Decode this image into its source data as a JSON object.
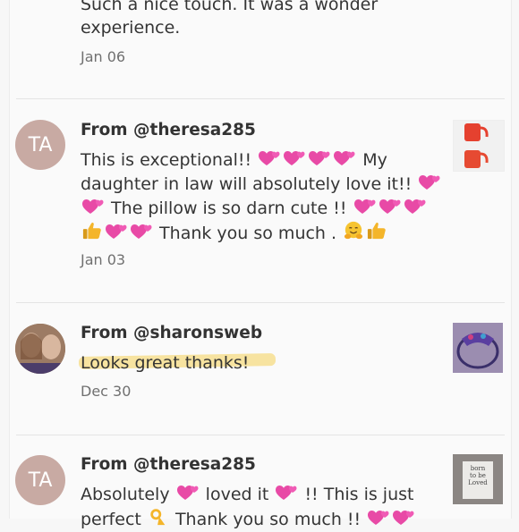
{
  "review0": {
    "text_line1": "Such a nice touch. It was a wonder",
    "text_line2": "experience.",
    "date": "Jan 06"
  },
  "review1": {
    "from": "From @theresa285",
    "avatar_initials": "TA",
    "line1_a": "This is exceptional!!",
    "line1_b": "My",
    "line2_a": "daughter in law will absolutely love it!!",
    "line3_a": "The pillow is so darn cute !!",
    "line4_a": "Thank you so much .",
    "date": "Jan 03"
  },
  "review2": {
    "from": "From @sharonsweb",
    "text": "Looks great thanks!",
    "date": "Dec 30",
    "highlight_color": "#f7e3a0"
  },
  "review3": {
    "from": "From @theresa285",
    "avatar_initials": "TA",
    "line1_a": "Absolutely",
    "line1_b": "loved it",
    "line1_c": "!! This is just",
    "line2_a": "perfect",
    "line2_b": "Thank you so much !!",
    "thumb_text_1": "born",
    "thumb_text_2": "to be",
    "thumb_text_3": "Loved"
  },
  "icons": {
    "heart": "two-hearts-emoji-icon",
    "thumbs": "thumbs-up-emoji-icon",
    "hug": "hugging-face-emoji-icon",
    "ok": "ok-hand-emoji-icon"
  },
  "colors": {
    "avatar_bg": "#c8aaa3",
    "heart_pink": "#e84aa6",
    "thumb_yellow": "#f4b52a"
  }
}
